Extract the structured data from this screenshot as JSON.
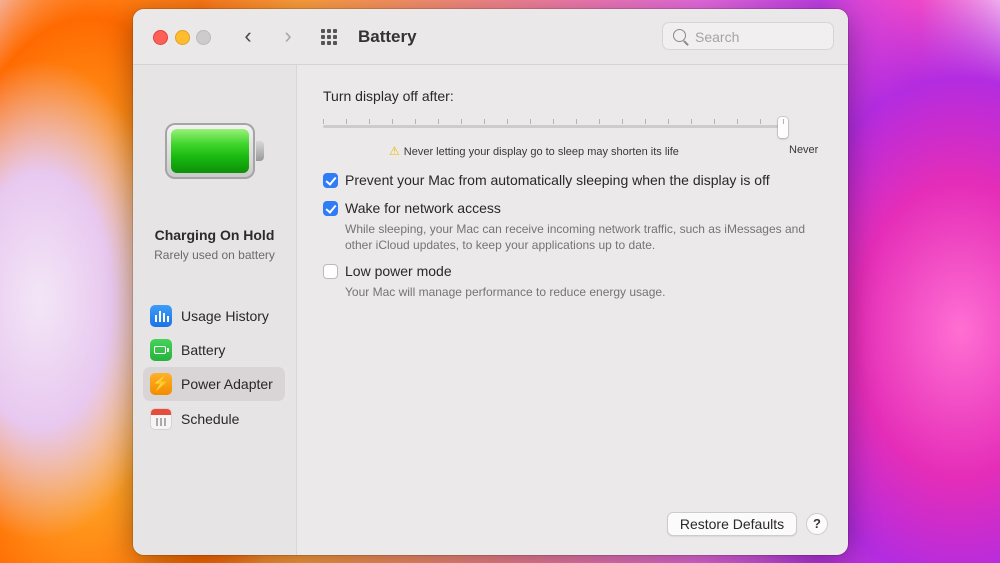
{
  "window": {
    "title": "Battery",
    "search_placeholder": "Search"
  },
  "sidebar": {
    "status_title": "Charging On Hold",
    "status_subtitle": "Rarely used on battery",
    "items": [
      {
        "label": "Usage History",
        "icon": "bar-chart-icon",
        "selected": false
      },
      {
        "label": "Battery",
        "icon": "battery-icon",
        "selected": false
      },
      {
        "label": "Power Adapter",
        "icon": "lightning-bolt-icon",
        "selected": true
      },
      {
        "label": "Schedule",
        "icon": "calendar-icon",
        "selected": false
      }
    ]
  },
  "main": {
    "slider_label": "Turn display off after:",
    "slider_value": "Never",
    "slider_level": 1.0,
    "warning_text": "Never letting your display go to sleep may shorten its life",
    "never_label": "Never",
    "options": [
      {
        "label": "Prevent your Mac from automatically sleeping when the display is off",
        "checked": true,
        "description": ""
      },
      {
        "label": "Wake for network access",
        "checked": true,
        "description": "While sleeping, your Mac can receive incoming network traffic, such as iMessages and other iCloud updates, to keep your applications up to date."
      },
      {
        "label": "Low power mode",
        "checked": false,
        "description": "Your Mac will manage performance to reduce energy usage."
      }
    ],
    "restore_button": "Restore Defaults",
    "help_button": "?"
  },
  "colors": {
    "accent": "#2f7cf6",
    "warning": "#f3b800"
  }
}
